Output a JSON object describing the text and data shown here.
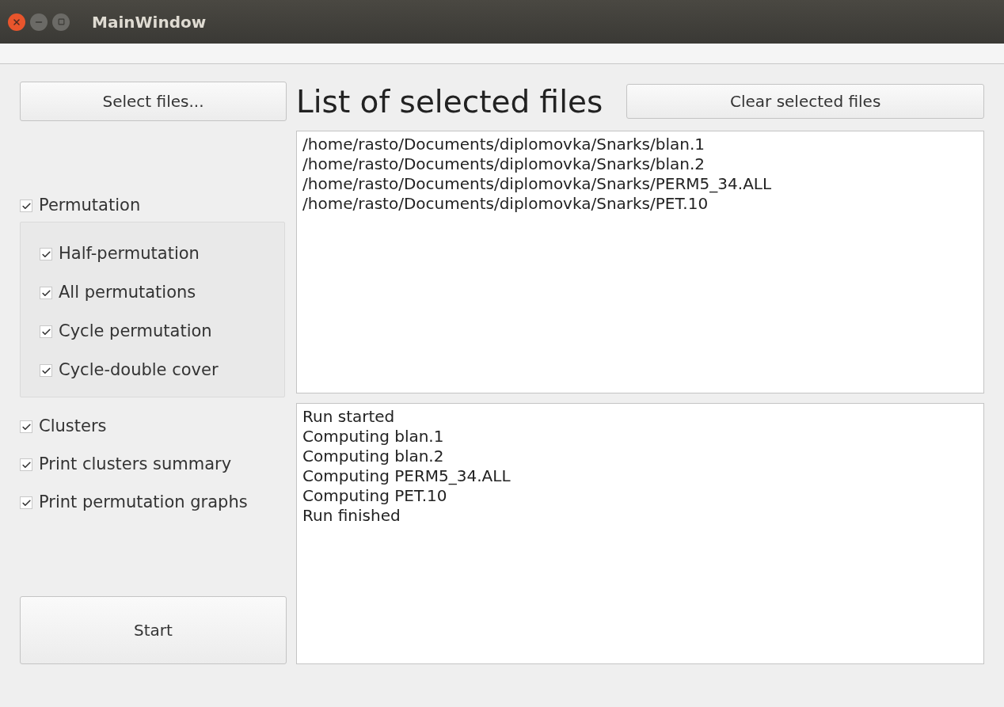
{
  "window": {
    "title": "MainWindow"
  },
  "select_button": "Select files...",
  "options": [
    {
      "label": "Permutation",
      "checked": true,
      "children": [
        {
          "label": "Half-permutation",
          "checked": true
        },
        {
          "label": "All permutations",
          "checked": true
        },
        {
          "label": "Cycle permutation",
          "checked": true
        },
        {
          "label": "Cycle-double cover",
          "checked": true
        }
      ]
    },
    {
      "label": "Clusters",
      "checked": true
    },
    {
      "label": "Print clusters summary",
      "checked": true
    },
    {
      "label": "Print permutation graphs",
      "checked": true
    }
  ],
  "start_button": "Start",
  "files_heading": "List of selected files",
  "clear_button": "Clear selected files",
  "files": [
    "/home/rasto/Documents/diplomovka/Snarks/blan.1",
    "/home/rasto/Documents/diplomovka/Snarks/blan.2",
    "/home/rasto/Documents/diplomovka/Snarks/PERM5_34.ALL",
    "/home/rasto/Documents/diplomovka/Snarks/PET.10"
  ],
  "log": [
    "Run started",
    "Computing blan.1",
    "Computing blan.2",
    "Computing PERM5_34.ALL",
    "Computing PET.10",
    "Run finished"
  ]
}
